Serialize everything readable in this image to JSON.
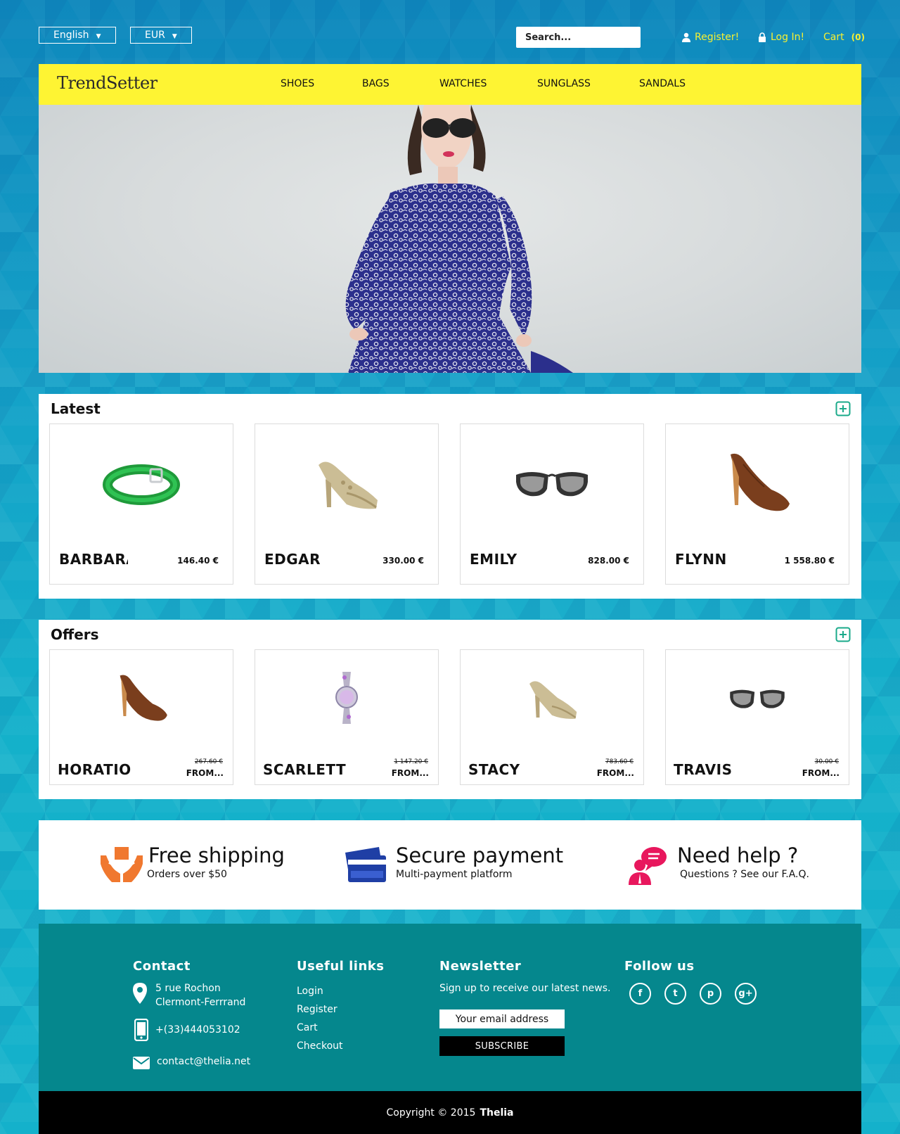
{
  "topbar": {
    "language": "English",
    "currency": "EUR",
    "search_placeholder": "Search...",
    "register": "Register!",
    "login": "Log In!",
    "cart_label": "Cart",
    "cart_count": "(0)"
  },
  "header": {
    "logo": "TrendSetter",
    "nav": [
      "SHOES",
      "BAGS",
      "WATCHES",
      "SUNGLASS",
      "SANDALS"
    ]
  },
  "latest": {
    "title": "Latest",
    "products": [
      {
        "name": "BARBARA",
        "price": "146.40 €",
        "image": "green-belt"
      },
      {
        "name": "EDGAR",
        "price": "330.00 €",
        "image": "beige-sandal"
      },
      {
        "name": "EMILY",
        "price": "828.00 €",
        "image": "sunglasses"
      },
      {
        "name": "FLYNN",
        "price": "1 558.80 €",
        "image": "brown-pump"
      }
    ]
  },
  "offers": {
    "title": "Offers",
    "from_label": "FROM...",
    "products": [
      {
        "name": "HORATIO",
        "old_price": "267.60 €",
        "image": "brown-pump"
      },
      {
        "name": "SCARLETT",
        "old_price": "1 147.20 €",
        "image": "jeweled-watch"
      },
      {
        "name": "STACY",
        "old_price": "783.60 €",
        "image": "beige-sandal"
      },
      {
        "name": "TRAVIS",
        "old_price": "30.00 €",
        "image": "sunglasses"
      }
    ]
  },
  "features": [
    {
      "title": "Free shipping",
      "subtitle": "Orders over $50",
      "icon": "hands-box-icon",
      "color": "#f0782f"
    },
    {
      "title": "Secure payment",
      "subtitle": "Multi-payment platform",
      "icon": "credit-card-icon",
      "color": "#1f3fa5"
    },
    {
      "title": "Need help ?",
      "subtitle": "Questions ? See our F.A.Q.",
      "icon": "support-chat-icon",
      "color": "#e8175d"
    }
  ],
  "footer": {
    "contact": {
      "heading": "Contact",
      "address_line1": "5 rue Rochon",
      "address_line2": "Clermont-Ferrrand",
      "phone": "+(33)444053102",
      "email": "contact@thelia.net"
    },
    "links": {
      "heading": "Useful links",
      "items": [
        "Login",
        "Register",
        "Cart",
        "Checkout"
      ]
    },
    "newsletter": {
      "heading": "Newsletter",
      "text": "Sign up to receive our latest news.",
      "placeholder": "Your email address",
      "button": "SUBSCRIBE"
    },
    "follow": {
      "heading": "Follow us",
      "networks": [
        {
          "name": "facebook",
          "glyph": "f"
        },
        {
          "name": "tumblr",
          "glyph": "t"
        },
        {
          "name": "pinterest",
          "glyph": "p"
        },
        {
          "name": "google-plus",
          "glyph": "g+"
        }
      ]
    }
  },
  "copyright": {
    "text": "Copyright ©  2015",
    "brand": "Thelia"
  },
  "colors": {
    "header_yellow": "#fef433",
    "top_link_yellow": "#f6f031",
    "footer_teal": "#05878d",
    "more_icon_green": "#1aaa8a"
  }
}
